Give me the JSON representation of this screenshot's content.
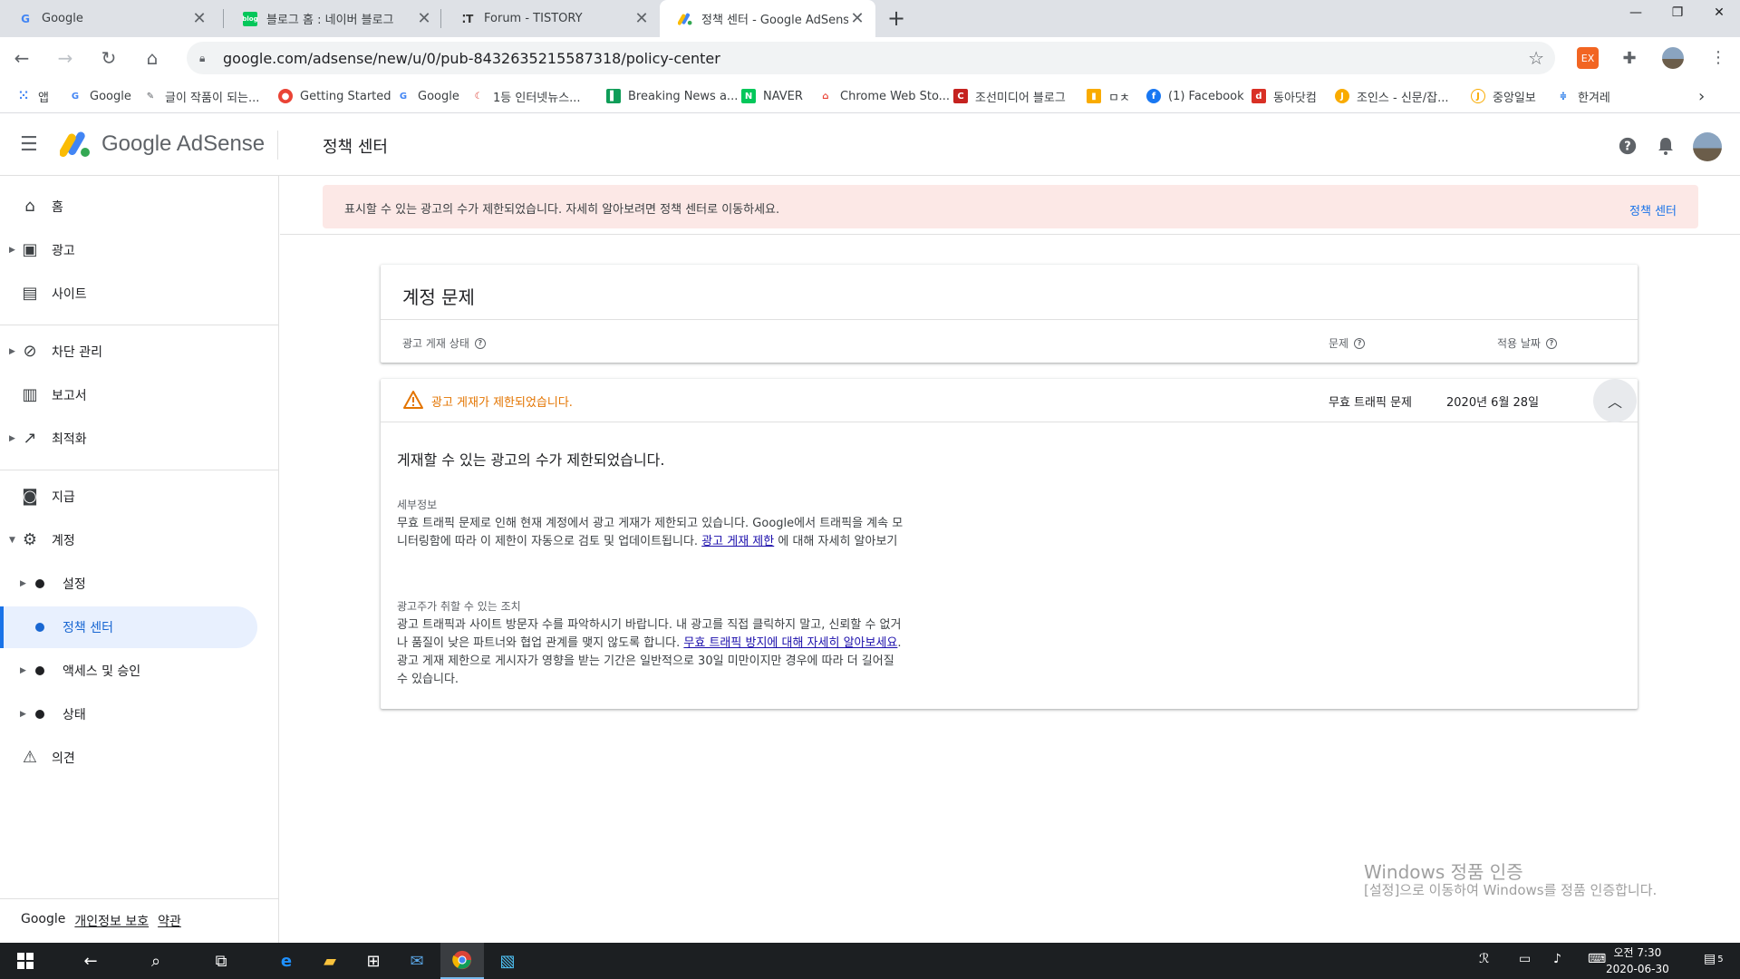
{
  "browser": {
    "tabs": [
      {
        "title": "Google",
        "favicon": "G"
      },
      {
        "title": "블로그 홈 : 네이버 블로그",
        "favicon": "blog"
      },
      {
        "title": "Forum - TISTORY",
        "favicon": "T"
      },
      {
        "title": "정책 센터 - Google AdSense",
        "favicon": "A"
      }
    ],
    "url": "google.com/adsense/new/u/0/pub-8432635215587318/policy-center",
    "bookmarks": [
      {
        "label": "앱",
        "color": "#4285f4"
      },
      {
        "label": "Google",
        "color": "#4285f4"
      },
      {
        "label": "글이 작품이 되는...",
        "color": "#5f6368"
      },
      {
        "label": "Getting Started",
        "color": "#ea4335"
      },
      {
        "label": "Google",
        "color": "#4285f4"
      },
      {
        "label": "1등 인터넷뉴스...",
        "color": "#d93025"
      },
      {
        "label": "Breaking News a...",
        "color": "#0f9d58"
      },
      {
        "label": "NAVER",
        "color": "#03c75a"
      },
      {
        "label": "Chrome Web Sto...",
        "color": "#ea4335"
      },
      {
        "label": "조선미디어 블로그",
        "color": "#c5221f"
      },
      {
        "label": "ㅁㅊ",
        "color": "#f9ab00"
      },
      {
        "label": "(1) Facebook",
        "color": "#1877f2"
      },
      {
        "label": "동아닷컴",
        "color": "#d93025"
      },
      {
        "label": "조인스 - 신문/잡...",
        "color": "#f9ab00"
      },
      {
        "label": "중앙일보",
        "color": "#f9ab00"
      },
      {
        "label": "한겨레",
        "color": "#1a73e8"
      }
    ]
  },
  "app": {
    "logo_text": "Google AdSense",
    "page_title": "정책 센터"
  },
  "sidebar": {
    "items": [
      {
        "label": "홈",
        "icon": "home-icon"
      },
      {
        "label": "광고",
        "icon": "ads-icon"
      },
      {
        "label": "사이트",
        "icon": "sites-icon"
      },
      {
        "label": "차단 관리",
        "icon": "block-icon"
      },
      {
        "label": "보고서",
        "icon": "reports-icon"
      },
      {
        "label": "최적화",
        "icon": "trending-icon"
      },
      {
        "label": "지급",
        "icon": "payments-icon"
      },
      {
        "label": "계정",
        "icon": "gear-icon"
      },
      {
        "label": "설정",
        "icon": "dot"
      },
      {
        "label": "정책 센터",
        "icon": "dot"
      },
      {
        "label": "액세스 및 승인",
        "icon": "dot"
      },
      {
        "label": "상태",
        "icon": "dot"
      },
      {
        "label": "의견",
        "icon": "feedback-icon"
      }
    ],
    "footer": {
      "brand": "Google",
      "privacy": "개인정보 보호",
      "terms": "약관"
    }
  },
  "banner": {
    "message": "표시할 수 있는 광고의 수가 제한되었습니다. 자세히 알아보려면 정책 센터로 이동하세요.",
    "link": "정책 센터"
  },
  "account_issues": {
    "title": "계정 문제",
    "col_status": "광고 게재 상태",
    "col_issue": "문제",
    "col_date": "적용 날짜"
  },
  "issue": {
    "status": "광고 게재가 제한되었습니다.",
    "issue": "무효 트래픽 문제",
    "date": "2020년 6월 28일",
    "detail_title": "게재할 수 있는 광고의 수가 제한되었습니다.",
    "details_label": "세부정보",
    "details_text_1": "무효 트래픽 문제로 인해 현재 계정에서 광고 게재가 제한되고 있습니다. Google에서 트래픽을 계속 모니터링함에 따라 이 제한이 자동으로 검토 및 업데이트됩니다.",
    "details_link": "광고 게재 제한",
    "details_text_2": "에 대해 자세히 알아보기",
    "actions_label": "광고주가 취할 수 있는 조치",
    "actions_text_1": "광고 트래픽과 사이트 방문자 수를 파악하시기 바랍니다. 내 광고를 직접 클릭하지 말고, 신뢰할 수 없거나 품질이 낮은 파트너와 협업 관계를 맺지 않도록 합니다.",
    "actions_link": "무효 트래픽 방지에 대해 자세히 알아보세요",
    "actions_text_2": ". 광고 게재 제한으로 게시자가 영향을 받는 기간은 일반적으로 30일 미만이지만 경우에 따라 더 길어질 수 있습니다."
  },
  "watermark": {
    "line1": "Windows 정품 인증",
    "line2": "[설정]으로 이동하여 Windows를 정품 인증합니다."
  },
  "taskbar": {
    "time": "오전 7:30",
    "date": "2020-06-30",
    "notifications": "5"
  }
}
